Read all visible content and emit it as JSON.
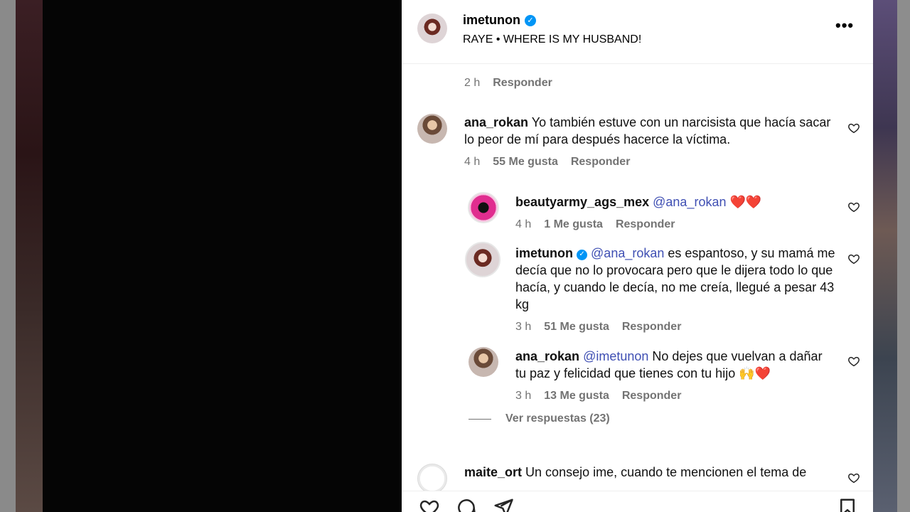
{
  "header": {
    "username": "imetunon",
    "subtitle": "RAYE • WHERE IS MY HUSBAND!"
  },
  "top_comment_meta": {
    "time": "2 h",
    "reply": "Responder"
  },
  "comments": [
    {
      "username": "ana_rokan",
      "text": "Yo también estuve con un narcisista que hacía sacar lo peor de mí para después hacerce la víctima.",
      "time": "4 h",
      "likes": "55 Me gusta",
      "reply": "Responder"
    },
    {
      "username": "beautyarmy_ags_mex",
      "mention": "@ana_rokan",
      "text": " ❤️❤️",
      "time": "4 h",
      "likes": "1 Me gusta",
      "reply": "Responder"
    },
    {
      "username": "imetunon",
      "mention": "@ana_rokan",
      "text": " es espantoso, y su mamá me decía que no lo provocara pero que le dijera todo lo que hacía, y cuando le decía, no me creía, llegué a pesar 43 kg",
      "time": "3 h",
      "likes": "51 Me gusta",
      "reply": "Responder"
    },
    {
      "username": "ana_rokan",
      "mention": "@imetunon",
      "text": " No dejes que vuelvan a dañar tu paz y felicidad que tienes con tu hijo 🙌❤️",
      "time": "3 h",
      "likes": "13 Me gusta",
      "reply": "Responder"
    },
    {
      "username": "maite_ort",
      "text": "Un consejo ime, cuando te mencionen el tema de"
    }
  ],
  "view_replies": "Ver respuestas (23)",
  "icons": {
    "more": "more-options-icon",
    "verified": "verified-badge-icon",
    "like": "heart-icon",
    "comment": "comment-icon",
    "share": "share-icon",
    "save": "bookmark-icon"
  },
  "colors": {
    "mention": "#3f4fb3",
    "verified": "#0095f6",
    "meta": "#737373"
  }
}
